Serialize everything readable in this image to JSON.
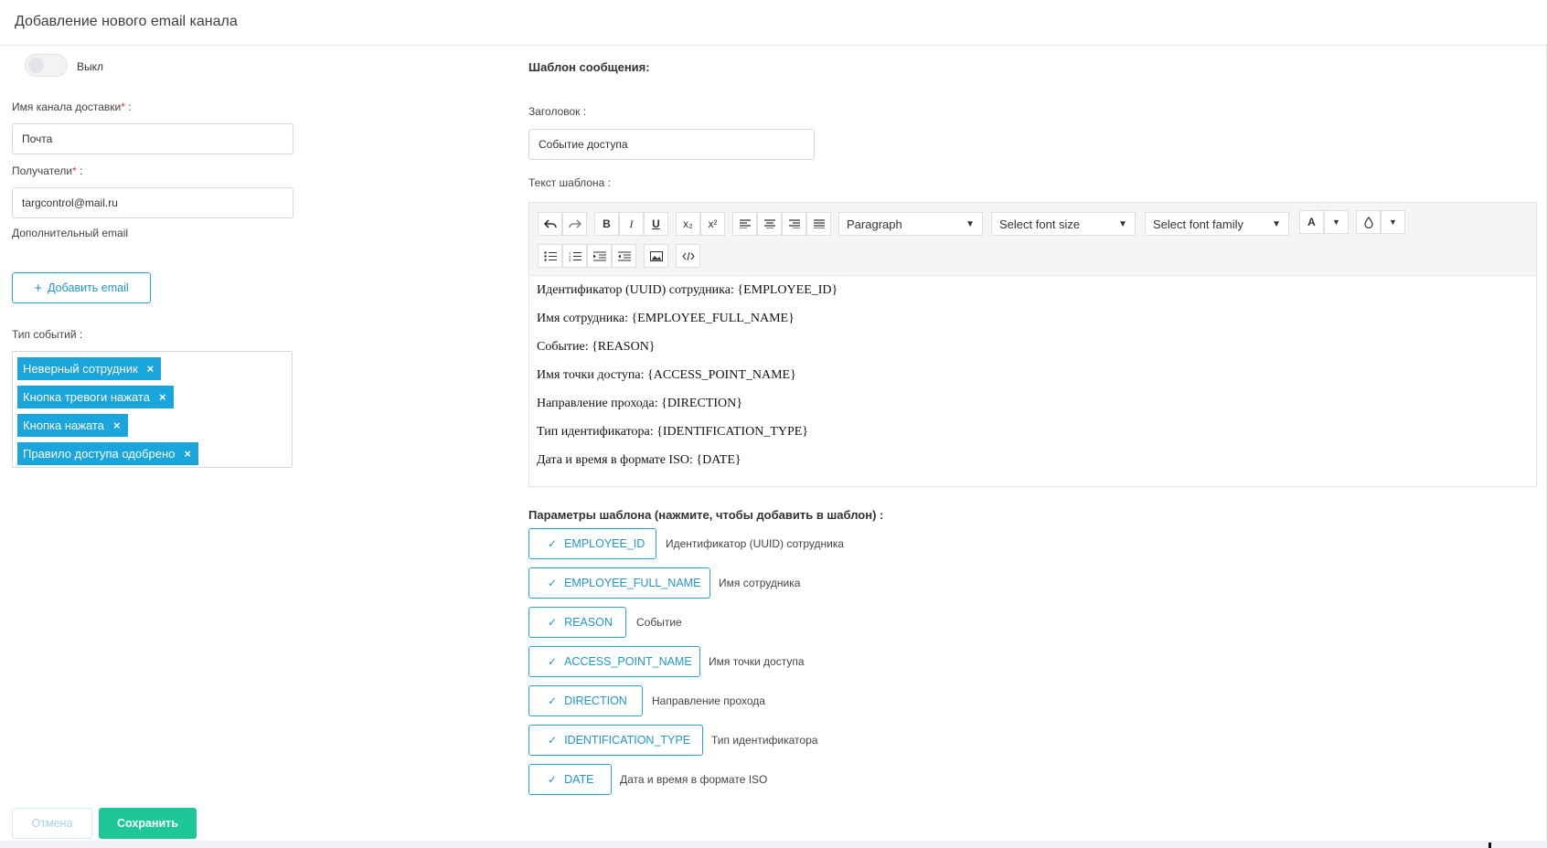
{
  "header": {
    "title": "Добавление нового email канала"
  },
  "toggle": {
    "label": "Выкл"
  },
  "channel_name": {
    "label": "Имя канала доставки",
    "required_mark": "*",
    "suffix": " :",
    "value": "Почта"
  },
  "recipients": {
    "label": "Получатели",
    "required_mark": "*",
    "suffix": " :",
    "value": "targcontrol@mail.ru"
  },
  "additional_email": {
    "label": "Дополнительный email",
    "add_button": "Добавить email",
    "add_icon": "+"
  },
  "event_types": {
    "label": "Тип событий :",
    "tags": [
      {
        "label": "Неверный сотрудник",
        "remove": "×"
      },
      {
        "label": "Кнопка тревоги нажата",
        "remove": "×"
      },
      {
        "label": "Кнопка нажата",
        "remove": "×"
      },
      {
        "label": "Правило доступа одобрено",
        "remove": "×"
      }
    ]
  },
  "template": {
    "section_title": "Шаблон сообщения:",
    "subject_label": "Заголовок :",
    "subject_value": "Событие доступа",
    "text_label": "Текст шаблона :",
    "toolbar": {
      "paragraph": "Paragraph",
      "font_size": "Select font size",
      "font_family": "Select font family",
      "bold": "B",
      "italic": "I",
      "underline": "U",
      "subscript": "x₂",
      "superscript": "x²",
      "font_color": "A",
      "dropdown_arrow": "▼"
    },
    "body_lines": [
      "Идентификатор (UUID) сотрудника: {EMPLOYEE_ID}",
      "Имя сотрудника: {EMPLOYEE_FULL_NAME}",
      "Событие: {REASON}",
      "Имя точки доступа: {ACCESS_POINT_NAME}",
      "Направление прохода: {DIRECTION}",
      "Тип идентификатора: {IDENTIFICATION_TYPE}",
      "Дата и время в формате ISO: {DATE}"
    ]
  },
  "params": {
    "title": "Параметры шаблона (нажмите, чтобы добавить в шаблон) :",
    "check_icon": "✓",
    "items": [
      {
        "key": "EMPLOYEE_ID",
        "desc": "Идентификатор (UUID) сотрудника"
      },
      {
        "key": "EMPLOYEE_FULL_NAME",
        "desc": "Имя сотрудника"
      },
      {
        "key": "REASON",
        "desc": "Событие"
      },
      {
        "key": "ACCESS_POINT_NAME",
        "desc": "Имя точки доступа"
      },
      {
        "key": "DIRECTION",
        "desc": "Направление прохода"
      },
      {
        "key": "IDENTIFICATION_TYPE",
        "desc": "Тип идентификатора"
      },
      {
        "key": "DATE",
        "desc": "Дата и время в формате ISO"
      }
    ]
  },
  "actions": {
    "cancel": "Отмена",
    "save": "Сохранить"
  },
  "colors": {
    "accent": "#1aa5dc",
    "save": "#1ec796",
    "required": "#e53935"
  }
}
